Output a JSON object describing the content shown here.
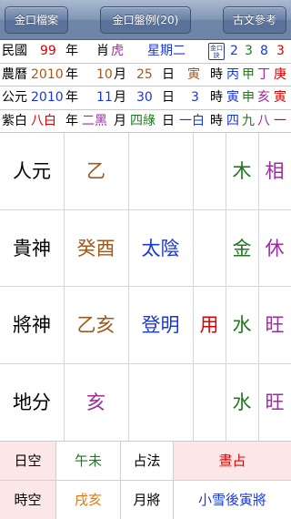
{
  "nav": {
    "left_label": "金口檔案",
    "title": "金口盤例(20)",
    "right_label": "古文參考"
  },
  "calendar": {
    "row1": {
      "era": "民國",
      "year_num": "99",
      "year_unit": "年",
      "zodiac_prefix": "肖",
      "zodiac": "虎",
      "weekday": "星期二",
      "seal": "金口 訣",
      "nums": [
        "2",
        "3",
        "8",
        "3"
      ]
    },
    "row2": {
      "label": "農曆",
      "year": "2010",
      "year_unit": "年",
      "month": "10",
      "month_unit": "月",
      "day": "25",
      "day_unit": "日",
      "hour_branch": "寅",
      "hour_unit": "時",
      "pillars": [
        "丙",
        "甲",
        "丁",
        "庚"
      ]
    },
    "row3": {
      "label": "公元",
      "year": "2010",
      "year_unit": "年",
      "month": "11",
      "month_unit": "月",
      "day": "30",
      "day_unit": "日",
      "hour": "3",
      "hour_unit": "時",
      "pillars": [
        "寅",
        "申",
        "亥",
        "寅"
      ]
    },
    "row4": {
      "label": "紫白",
      "year_star": "八白",
      "year_unit": "年",
      "month_star": "二黑",
      "month_unit": "月",
      "day_star": "四綠",
      "day_unit": "日",
      "hour_star": "一白",
      "hour_unit": "時",
      "extra": [
        "四",
        "九",
        "八",
        "一"
      ]
    }
  },
  "grid": {
    "rows": [
      {
        "label": "人元",
        "c1": "乙",
        "c2": "",
        "c3": "",
        "c4": "木",
        "c5": "相"
      },
      {
        "label": "貴神",
        "c1": "癸酉",
        "c2": "太陰",
        "c3": "",
        "c4": "金",
        "c5": "休"
      },
      {
        "label": "將神",
        "c1": "乙亥",
        "c2": "登明",
        "c3": "用",
        "c4": "水",
        "c5": "旺"
      },
      {
        "label": "地分",
        "c1": "亥",
        "c2": "",
        "c3": "",
        "c4": "水",
        "c5": "旺"
      }
    ]
  },
  "bottom": {
    "row1": {
      "a": "日空",
      "b": "午未",
      "c": "占法",
      "d": "晝占"
    },
    "row2": {
      "a": "時空",
      "b": "戌亥",
      "c": "月將",
      "d": "小雪後寅將"
    }
  },
  "colors": {
    "red": "#e00000",
    "blue": "#1a37d8",
    "brown": "#a05a1e",
    "green": "#1f7a1f",
    "purple": "#9b2da0",
    "orange": "#e07a10"
  }
}
